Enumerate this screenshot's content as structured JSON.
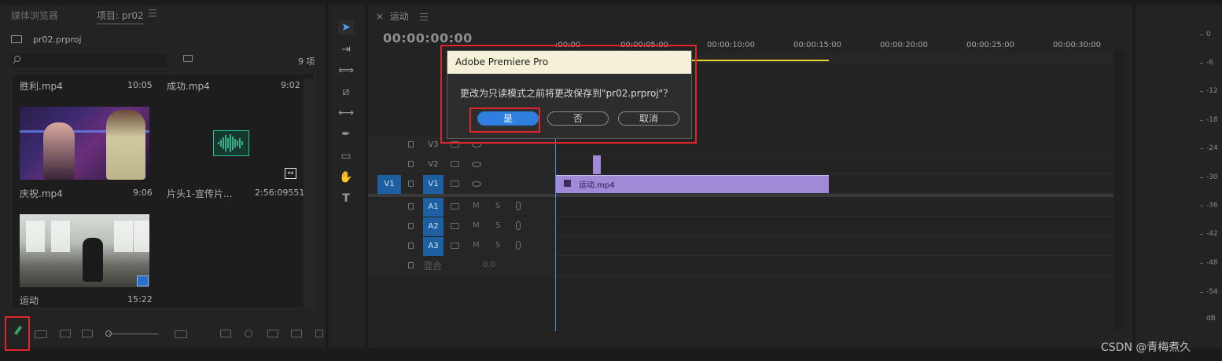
{
  "project_panel": {
    "tab_media_browser": "媒体浏览器",
    "tab_project": "项目: pr02",
    "project_file": "pr02.prproj",
    "item_count": "9 项",
    "clips": [
      {
        "name": "胜利.mp4",
        "duration": "10:05"
      },
      {
        "name": "成功.mp4",
        "duration": "9:02"
      },
      {
        "name": "庆祝.mp4",
        "duration": "9:06"
      },
      {
        "name": "片头1-宣传片...",
        "duration": "2:56:09551"
      },
      {
        "name": "运动",
        "duration": "15:22"
      }
    ]
  },
  "timeline": {
    "tab_label": "运动",
    "timecode": "00:00:00:00",
    "ruler_labels": [
      ":00:00",
      "00:00:05:00",
      "00:00:10:00",
      "00:00:15:00",
      "00:00:20:00",
      "00:00:25:00",
      "00:00:30:00"
    ],
    "tracks": {
      "v3": "V3",
      "v2": "V2",
      "v1": "V1",
      "source_v1": "V1",
      "a1": "A1",
      "a2": "A2",
      "a3": "A3",
      "mute": "M",
      "solo": "S"
    },
    "clip_v1_name": "运动.mp4",
    "mix_label": "混合",
    "mix_value": "0.0"
  },
  "dialog": {
    "title": "Adobe Premiere Pro",
    "message": "更改为只读模式之前将更改保存到\"pr02.prproj\"？",
    "yes": "是",
    "no": "否",
    "cancel": "取消"
  },
  "meter": {
    "db_labels": [
      "0",
      "-6",
      "-12",
      "-18",
      "-24",
      "-30",
      "-36",
      "-42",
      "-48",
      "-54",
      "dB"
    ]
  },
  "watermark": "CSDN @青梅煮久",
  "colors": {
    "accent_blue": "#2e7fe0",
    "highlight_red": "#e0262c",
    "clip_purple": "#a08ad8",
    "playhead": "#3a8fe0",
    "work_area_yellow": "#e8d12a"
  }
}
